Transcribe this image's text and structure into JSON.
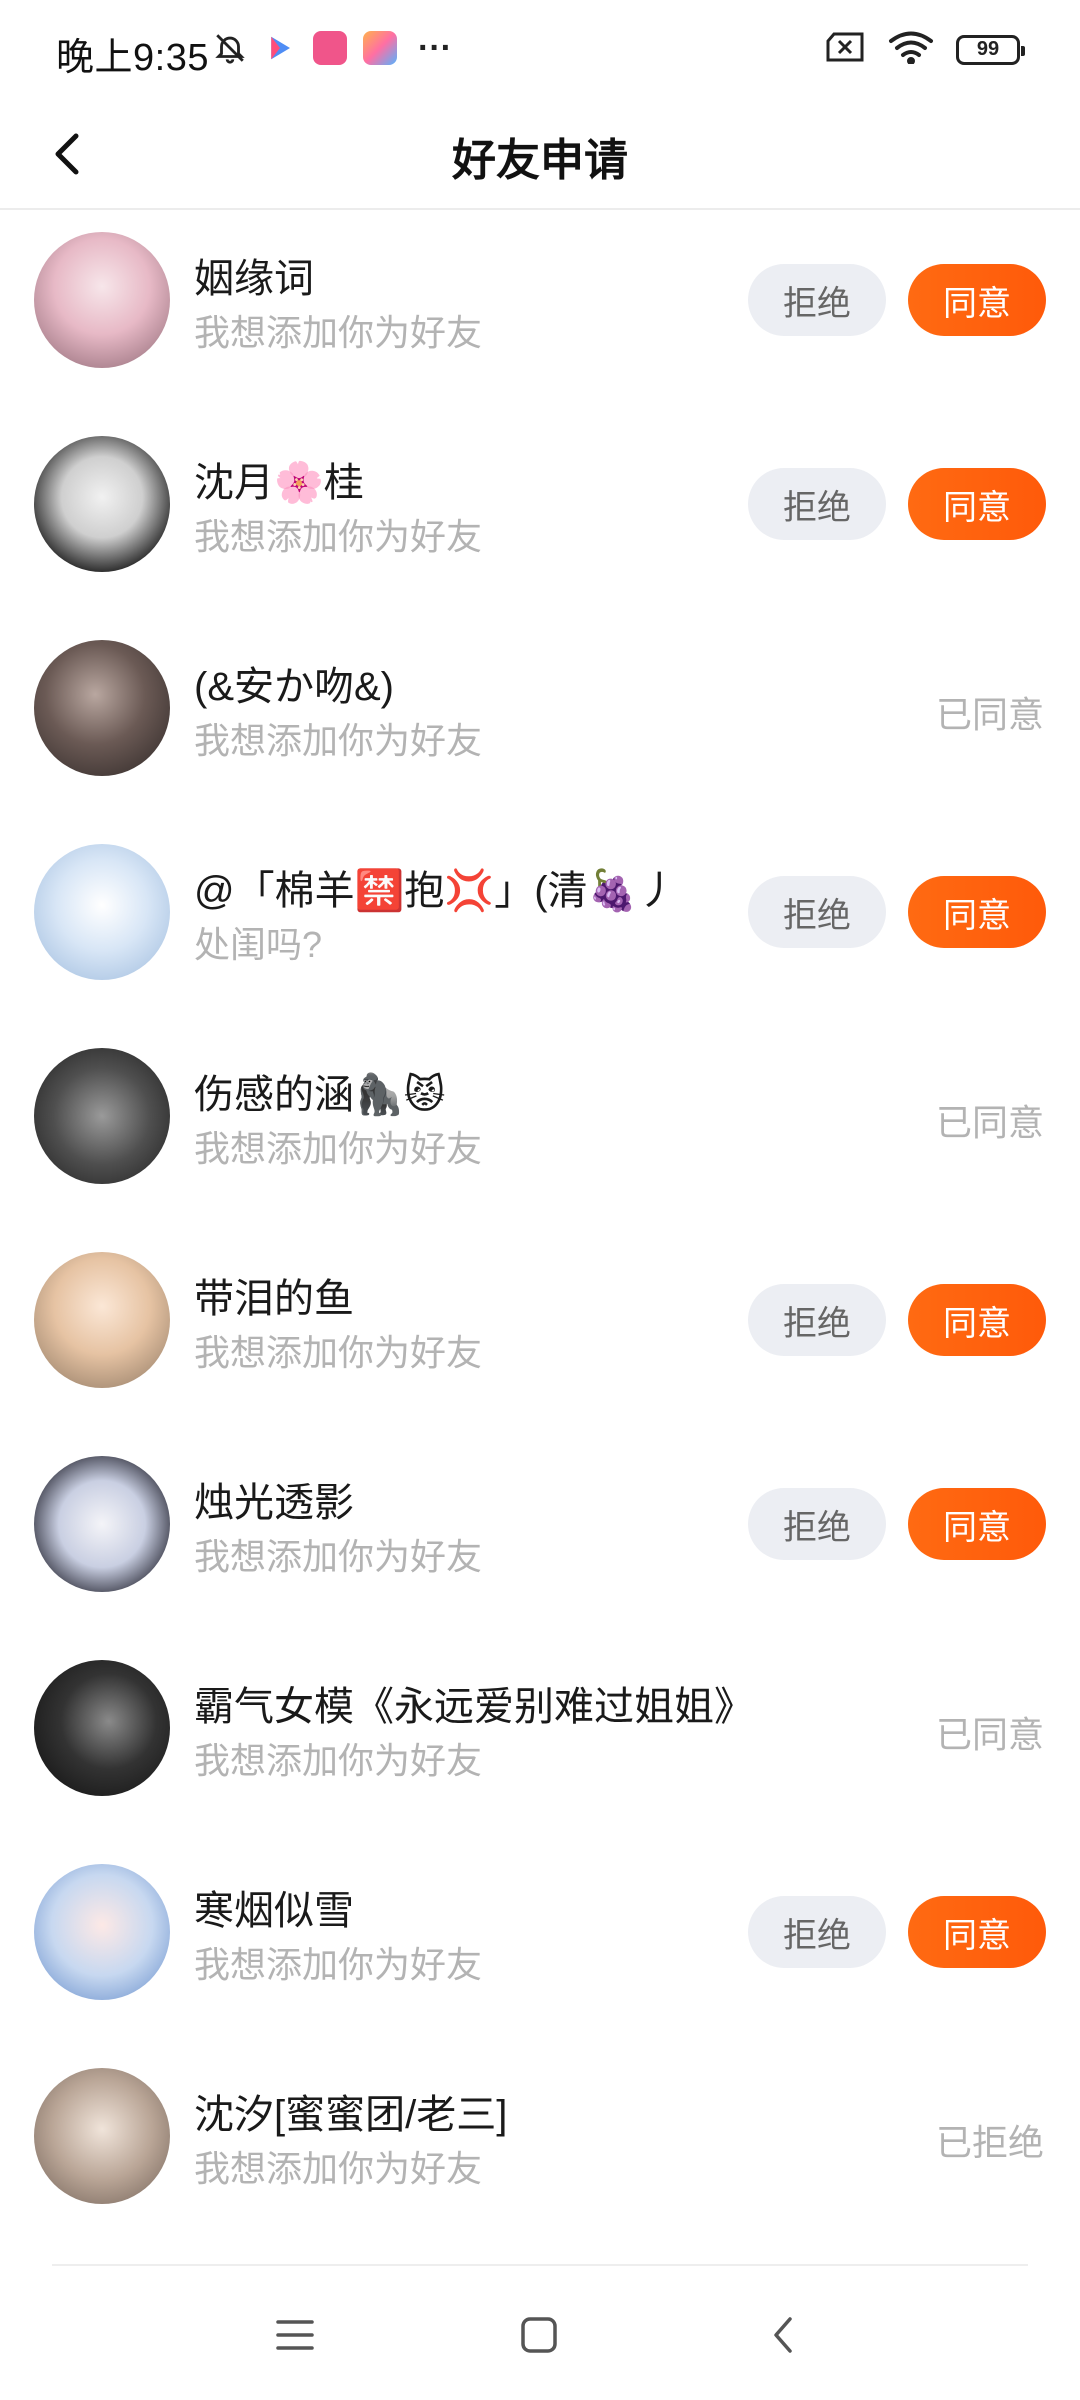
{
  "status_bar": {
    "time": "晚上9:35",
    "battery": "99",
    "more": "···",
    "icons": [
      "bell-off-icon",
      "play-app-icon",
      "bilibili-app-icon",
      "game-center-icon",
      "sim-off-icon",
      "wifi-icon",
      "battery-icon"
    ]
  },
  "header": {
    "title": "好友申请",
    "back_icon": "chevron-left-icon"
  },
  "buttons": {
    "reject": "拒绝",
    "accept": "同意"
  },
  "colors": {
    "accent": "#ff6212",
    "reject_bg": "#eceef3",
    "muted_text": "#b3b3b3"
  },
  "requests": [
    {
      "name": "姻缘词",
      "message": "我想添加你为好友",
      "state": "pending"
    },
    {
      "name": "沈月🌸桂",
      "message": "我想添加你为好友",
      "state": "pending"
    },
    {
      "name": "(&安か吻&)",
      "message": "我想添加你为好友",
      "state": "done",
      "status_text": "已同意"
    },
    {
      "name": "@「棉羊🈲抱💢」(清🍇丿",
      "message": "处闺吗?",
      "state": "pending"
    },
    {
      "name": "伤感的涵🦍😾",
      "message": "我想添加你为好友",
      "state": "done",
      "status_text": "已同意"
    },
    {
      "name": "带泪的鱼",
      "message": "我想添加你为好友",
      "state": "pending"
    },
    {
      "name": "烛光透影",
      "message": "我想添加你为好友",
      "state": "pending"
    },
    {
      "name": "霸气女模《永远爱别难过姐姐》",
      "message": "我想添加你为好友",
      "state": "done",
      "status_text": "已同意"
    },
    {
      "name": "寒烟似雪",
      "message": "我想添加你为好友",
      "state": "pending"
    },
    {
      "name": "沈汐[蜜蜜团/老三]",
      "message": "我想添加你为好友",
      "state": "done",
      "status_text": "已拒绝"
    }
  ],
  "system_nav": [
    "menu-icon",
    "home-icon",
    "back-icon"
  ]
}
